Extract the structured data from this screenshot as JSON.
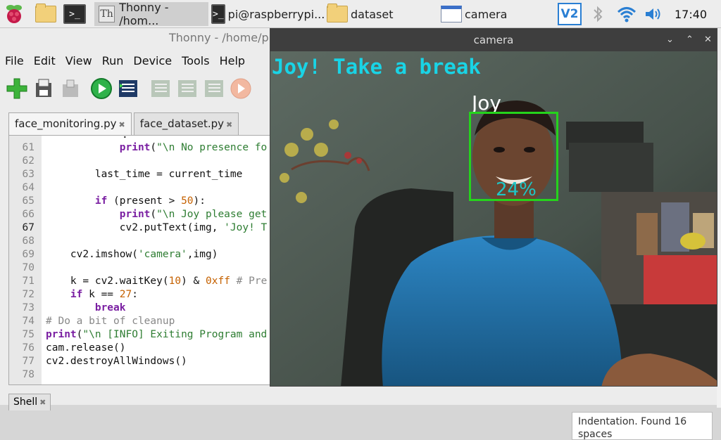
{
  "taskbar": {
    "thonny_task": "Thonny - /hom...",
    "terminal_task": "pi@raspberrypi...",
    "folder_task": "dataset",
    "camera_task": "camera",
    "clock": "17:40"
  },
  "thonny": {
    "title": "Thonny - /home/p",
    "menu": [
      "File",
      "Edit",
      "View",
      "Run",
      "Device",
      "Tools",
      "Help"
    ],
    "tabs": [
      {
        "label": "face_monitoring.py"
      },
      {
        "label": "face_dataset.py"
      }
    ],
    "shell_tab": "Shell",
    "assistant_text": "Indentation. Found 16 spaces"
  },
  "code_lines": [
    {
      "n": "61",
      "t": "            print(\"\\n No presence fo"
    },
    {
      "n": "62",
      "t": ""
    },
    {
      "n": "63",
      "t": "        last_time = current_time"
    },
    {
      "n": "64",
      "t": ""
    },
    {
      "n": "65",
      "t": "        if (present > 50):"
    },
    {
      "n": "66",
      "t": "            print(\"\\n Joy please get"
    },
    {
      "n": "67",
      "t": "            cv2.putText(img, 'Joy! T"
    },
    {
      "n": "68",
      "t": ""
    },
    {
      "n": "69",
      "t": "    cv2.imshow('camera',img)"
    },
    {
      "n": "70",
      "t": ""
    },
    {
      "n": "71",
      "t": "    k = cv2.waitKey(10) & 0xff # Pre"
    },
    {
      "n": "72",
      "t": "    if k == 27:"
    },
    {
      "n": "73",
      "t": "        break"
    },
    {
      "n": "74",
      "t": "# Do a bit of cleanup"
    },
    {
      "n": "75",
      "t": "print(\"\\n [INFO] Exiting Program and"
    },
    {
      "n": "76",
      "t": "cam.release()"
    },
    {
      "n": "77",
      "t": "cv2.destroyAllWindows()"
    },
    {
      "n": "78",
      "t": ""
    }
  ],
  "camera": {
    "title": "camera",
    "overlay_message": "Joy! Take a break",
    "face_name": "Joy",
    "confidence": "24%"
  },
  "icons": {
    "raspberry": "raspberry-menu-icon",
    "bluetooth": "bluetooth-icon",
    "wifi": "wifi-icon",
    "volume": "volume-icon",
    "vnc": "vnc-icon"
  }
}
